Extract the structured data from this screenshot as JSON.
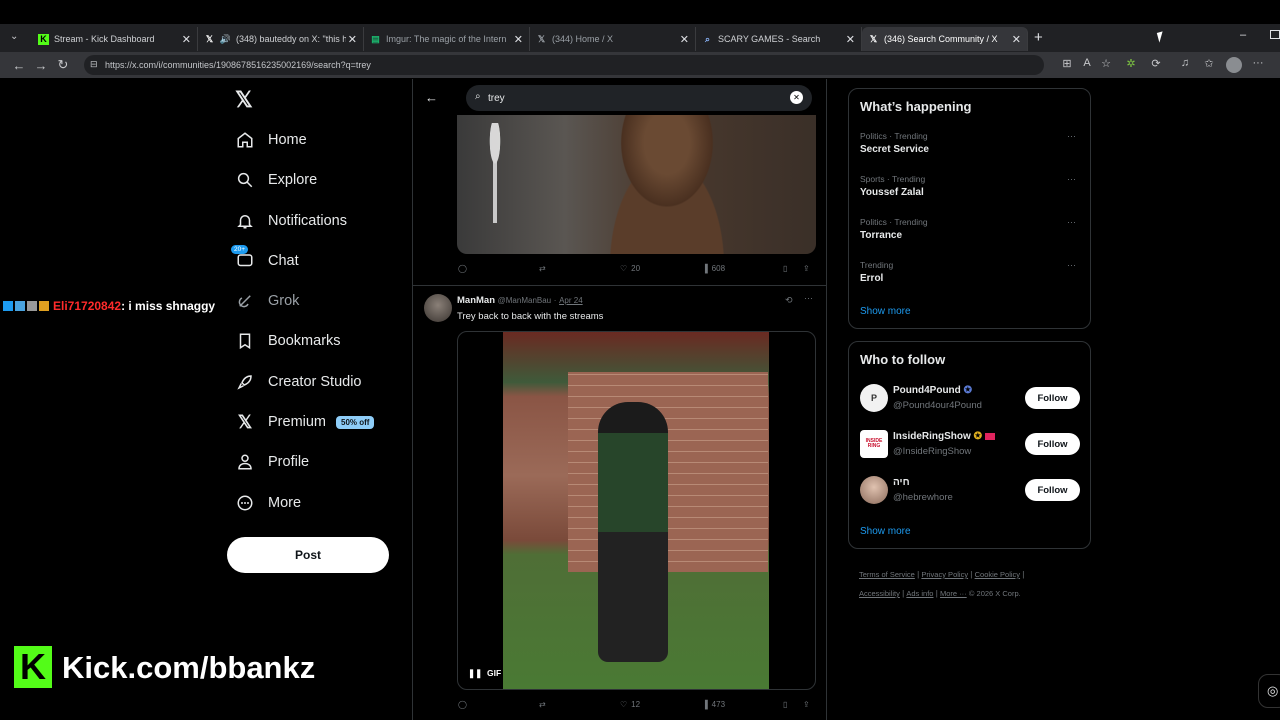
{
  "browser": {
    "tabs": [
      {
        "title": "Stream - Kick Dashboard",
        "icon": "kick-icon"
      },
      {
        "title": "(348) bauteddy on X: \"this ha",
        "icon": "x-logo-icon"
      },
      {
        "title": "Imgur: The magic of the Internet",
        "icon": "imgur-icon"
      },
      {
        "title": "(344) Home / X",
        "icon": "x-logo-icon"
      },
      {
        "title": "SCARY GAMES - Search",
        "icon": "search-icon"
      },
      {
        "title": "(346) Search Community / X",
        "icon": "x-logo-icon"
      }
    ],
    "url": "https://x.com/i/communities/1908678516235002169/search?q=trey"
  },
  "sidebar": {
    "items": [
      {
        "label": "Home"
      },
      {
        "label": "Explore"
      },
      {
        "label": "Notifications"
      },
      {
        "label": "Chat",
        "badge": "20+"
      },
      {
        "label": "Grok"
      },
      {
        "label": "Bookmarks"
      },
      {
        "label": "Creator Studio"
      },
      {
        "label": "Premium",
        "badge": "50% off"
      },
      {
        "label": "Profile"
      },
      {
        "label": "More"
      }
    ],
    "post_label": "Post"
  },
  "overlay": {
    "chat_user": "Eli71720842",
    "chat_message": ": i miss shnaggy",
    "kick_text": "Kick.com/bbankz"
  },
  "search": {
    "query": "trey"
  },
  "feed": {
    "post1": {
      "likes": "20",
      "views": "608"
    },
    "post2": {
      "author": "ManMan",
      "handle": "@ManManBau",
      "date": "Apr 24",
      "text": "Trey back to back with the streams",
      "gif_label": "GIF",
      "likes": "12",
      "views": "473"
    }
  },
  "trends": {
    "title": "What’s happening",
    "items": [
      {
        "category": "Politics · Trending",
        "name": "Secret Service"
      },
      {
        "category": "Sports · Trending",
        "name": "Youssef Zalal"
      },
      {
        "category": "Politics · Trending",
        "name": "Torrance"
      },
      {
        "category": "Trending",
        "name": "Errol"
      }
    ],
    "show_more": "Show more"
  },
  "who_to_follow": {
    "title": "Who to follow",
    "accounts": [
      {
        "name": "Pound4Pound",
        "handle": "@Pound4our4Pound",
        "avatar_letter": "P"
      },
      {
        "name": "InsideRingShow",
        "handle": "@InsideRingShow",
        "avatar_letter": "INSIDE RING"
      },
      {
        "name": "חיה",
        "handle": "@hebrewhore",
        "avatar_letter": ""
      }
    ],
    "follow_label": "Follow",
    "show_more": "Show more"
  },
  "footer": {
    "links": [
      "Terms of Service",
      "Privacy Policy",
      "Cookie Policy",
      "Accessibility",
      "Ads info",
      "More ···"
    ],
    "copyright": "© 2026 X Corp."
  },
  "colors": {
    "accent": "#1d9bf0",
    "kick_green": "#53fc18",
    "chat_user": "#ff2b2b",
    "premium_badge": "#8ecdf8"
  }
}
